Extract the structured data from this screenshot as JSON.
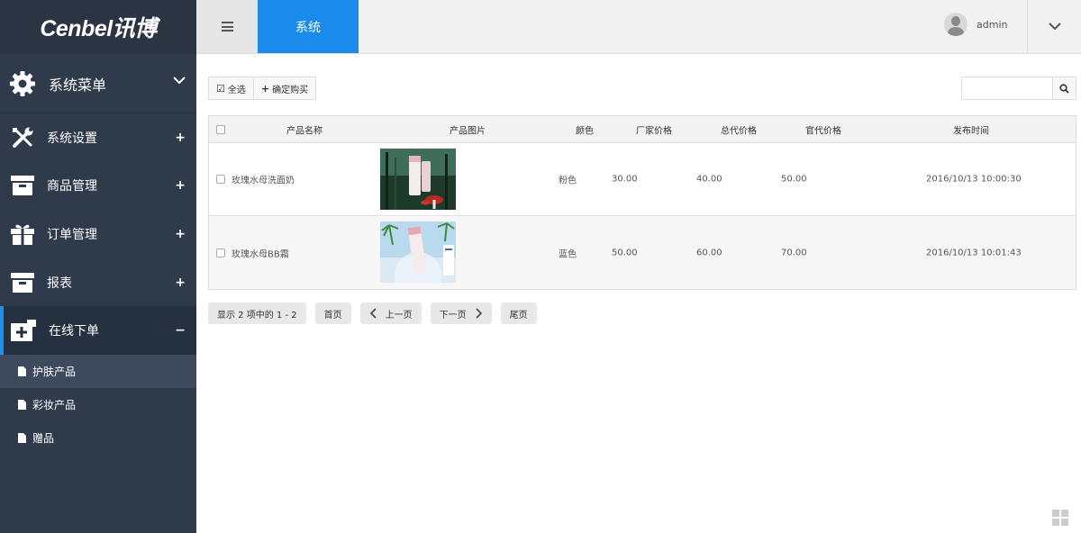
{
  "brand": {
    "logo": "Cenbel讯博"
  },
  "sidebar": {
    "menu_title": "系统菜单",
    "items": [
      {
        "label": "系统设置",
        "sign": "+",
        "icon": "wrench-screwdriver-icon"
      },
      {
        "label": "商品管理",
        "sign": "+",
        "icon": "archive-box-icon"
      },
      {
        "label": "订单管理",
        "sign": "+",
        "icon": "gift-icon"
      },
      {
        "label": "报表",
        "sign": "+",
        "icon": "archive-box-icon"
      },
      {
        "label": "在线下单",
        "sign": "−",
        "icon": "add-square-icon"
      }
    ],
    "sub_items": [
      {
        "label": "护肤产品"
      },
      {
        "label": "彩妆产品"
      },
      {
        "label": "赠品"
      }
    ]
  },
  "topbar": {
    "tab": "系统",
    "username": "admin"
  },
  "toolbar": {
    "select_all": "全选",
    "confirm_buy": "确定购买",
    "search_placeholder": ""
  },
  "table": {
    "headers": [
      "产品名称",
      "产品图片",
      "颜色",
      "厂家价格",
      "总代价格",
      "官代价格",
      "发布时间"
    ],
    "rows": [
      {
        "name": "玫瑰水母洗面奶",
        "color": "粉色",
        "factory": "30.00",
        "general": "40.00",
        "official": "50.00",
        "time": "2016/10/13 10:00:30"
      },
      {
        "name": "玫瑰水母BB霜",
        "color": "蓝色",
        "factory": "50.00",
        "general": "60.00",
        "official": "70.00",
        "time": "2016/10/13 10:01:43"
      }
    ]
  },
  "pager": {
    "info": "显示 2 项中的 1 - 2",
    "first": "首页",
    "prev": "上一页",
    "next": "下一页",
    "last": "尾页"
  },
  "colors": {
    "sidebar": "#2f3a4b",
    "accent": "#1a8bec"
  }
}
